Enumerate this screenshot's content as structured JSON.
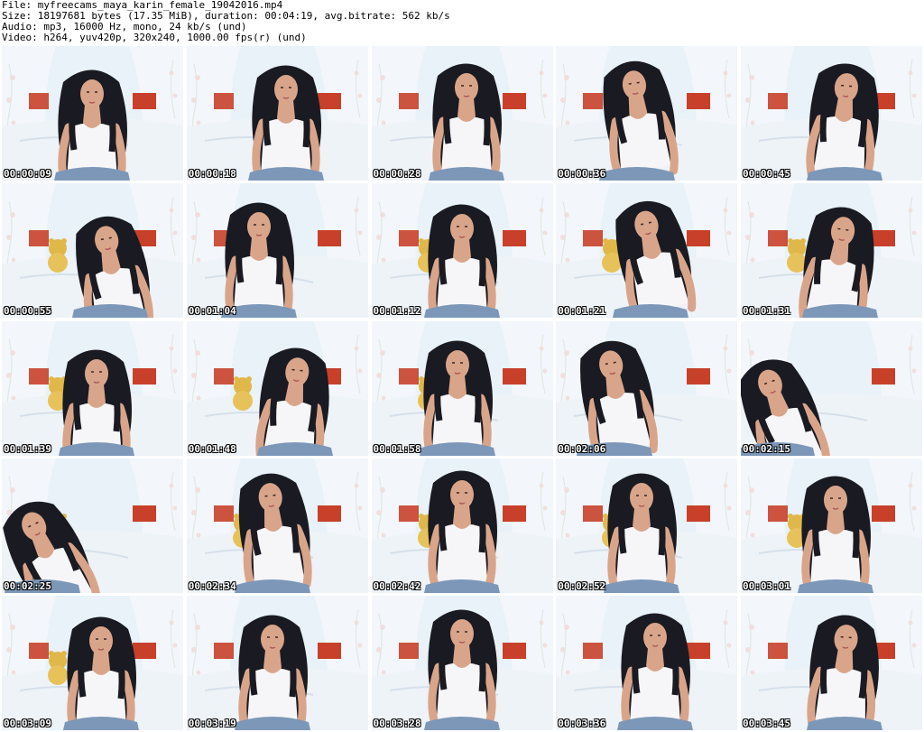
{
  "header": {
    "file_line": "File: myfreecams_maya_karin_female_19042016.mp4",
    "size_line": "Size: 18197681 bytes (17.35 MiB), duration: 00:04:19, avg.bitrate: 562 kb/s",
    "audio_line": "Audio: mp3, 16000 Hz, mono, 24 kb/s (und)",
    "video_line": "Video: h264, yuv420p, 320x240, 1000.00 fps(r) (und)"
  },
  "thumbnails": [
    {
      "timestamp": "00:00:09"
    },
    {
      "timestamp": "00:00:18"
    },
    {
      "timestamp": "00:00:28"
    },
    {
      "timestamp": "00:00:36"
    },
    {
      "timestamp": "00:00:45"
    },
    {
      "timestamp": "00:00:55"
    },
    {
      "timestamp": "00:01:04"
    },
    {
      "timestamp": "00:01:12"
    },
    {
      "timestamp": "00:01:21"
    },
    {
      "timestamp": "00:01:31"
    },
    {
      "timestamp": "00:01:39"
    },
    {
      "timestamp": "00:01:48"
    },
    {
      "timestamp": "00:01:58"
    },
    {
      "timestamp": "00:02:06"
    },
    {
      "timestamp": "00:02:15"
    },
    {
      "timestamp": "00:02:25"
    },
    {
      "timestamp": "00:02:34"
    },
    {
      "timestamp": "00:02:42"
    },
    {
      "timestamp": "00:02:52"
    },
    {
      "timestamp": "00:03:01"
    },
    {
      "timestamp": "00:03:09"
    },
    {
      "timestamp": "00:03:19"
    },
    {
      "timestamp": "00:03:28"
    },
    {
      "timestamp": "00:03:36"
    },
    {
      "timestamp": "00:03:45"
    }
  ],
  "colors": {
    "background": "#ffffff",
    "frame_wall": "#e8f2f8",
    "curtain": "#f4f8fb",
    "headboard": "#c8402a",
    "bed": "#eef3f8",
    "hair": "#1a1a22",
    "skin": "#d9a58a",
    "top": "#f6f6f8",
    "jeans": "#7c97b8",
    "timestamp_text": "#ffffff"
  }
}
